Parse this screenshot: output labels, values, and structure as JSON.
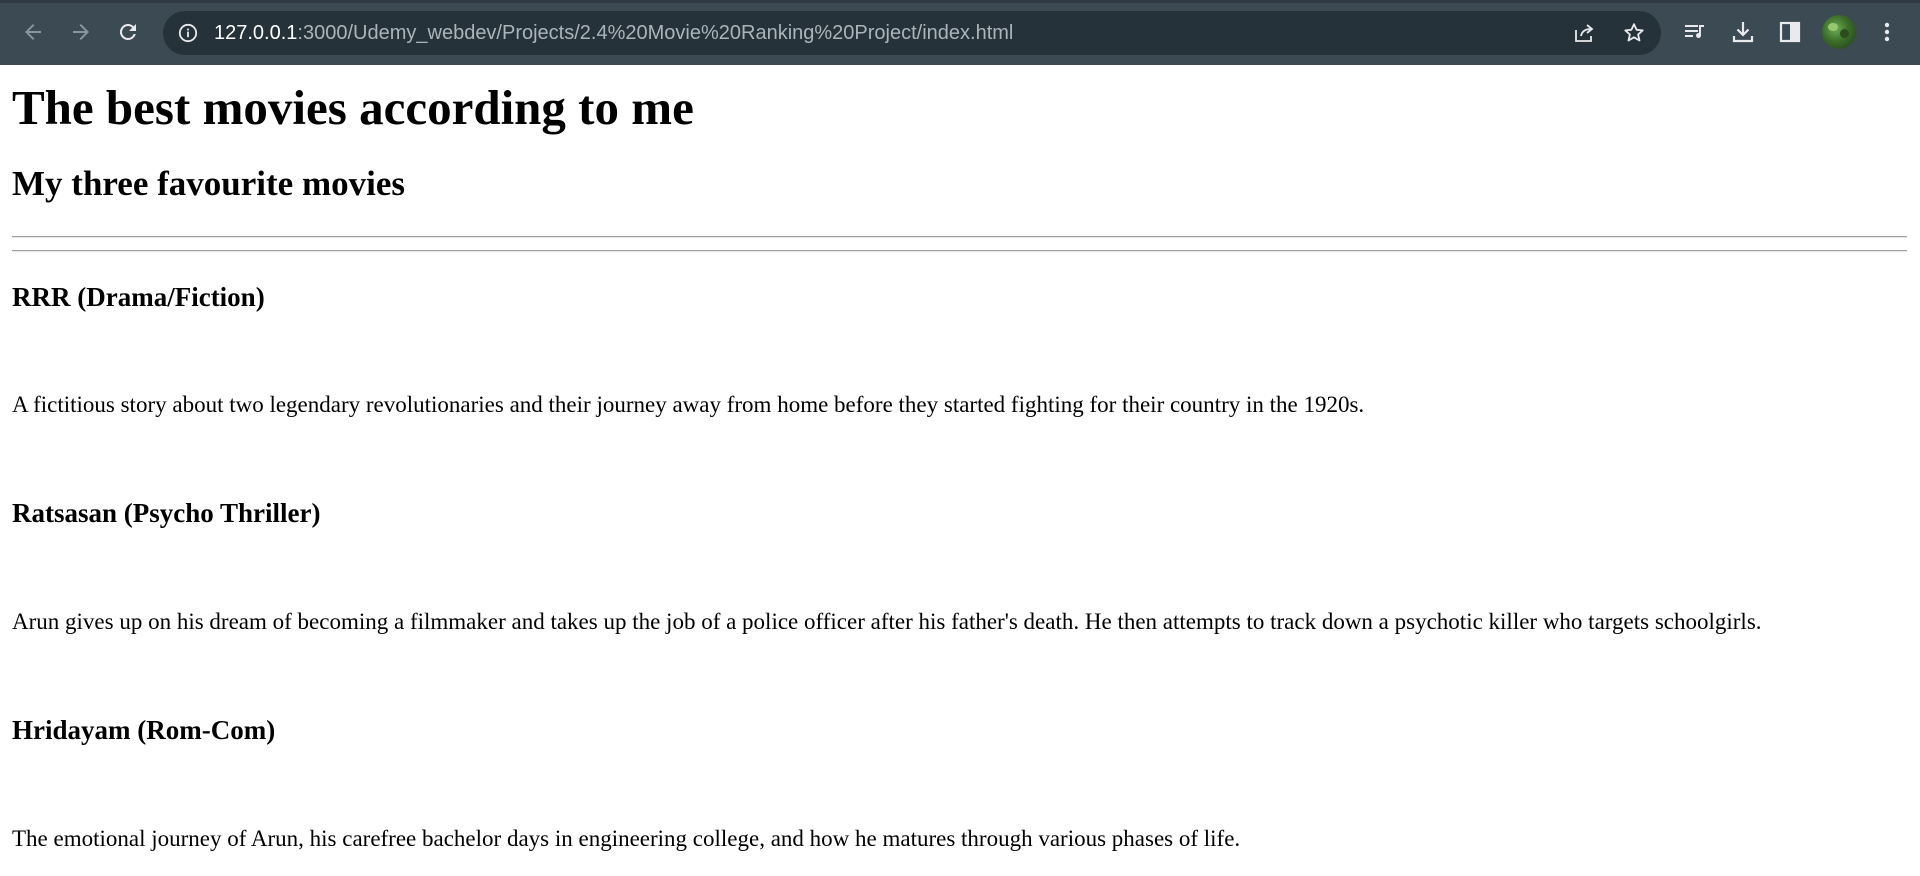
{
  "browser": {
    "url_host": "127.0.0.1",
    "url_rest": ":3000/Udemy_webdev/Projects/2.4%20Movie%20Ranking%20Project/index.html",
    "icons": {
      "back": "back-arrow-icon",
      "forward": "forward-arrow-icon",
      "reload": "reload-icon",
      "info": "info-icon",
      "share": "share-icon",
      "bookmark": "star-icon",
      "media": "media-queue-icon",
      "download": "download-icon",
      "side_panel": "side-panel-icon",
      "menu": "kebab-menu-icon"
    },
    "colors": {
      "toolbar": "#3c4a54",
      "omnibox": "#26323a"
    }
  },
  "page": {
    "title": "The best movies according to me",
    "subtitle": "My three favourite movies",
    "movies": [
      {
        "title": "RRR (Drama/Fiction)",
        "description": "A fictitious story about two legendary revolutionaries and their journey away from home before they started fighting for their country in the 1920s."
      },
      {
        "title": "Ratsasan (Psycho Thriller)",
        "description": "Arun gives up on his dream of becoming a filmmaker and takes up the job of a police officer after his father's death. He then attempts to track down a psychotic killer who targets schoolgirls."
      },
      {
        "title": "Hridayam (Rom-Com)",
        "description": "The emotional journey of Arun, his carefree bachelor days in engineering college, and how he matures through various phases of life."
      }
    ]
  }
}
